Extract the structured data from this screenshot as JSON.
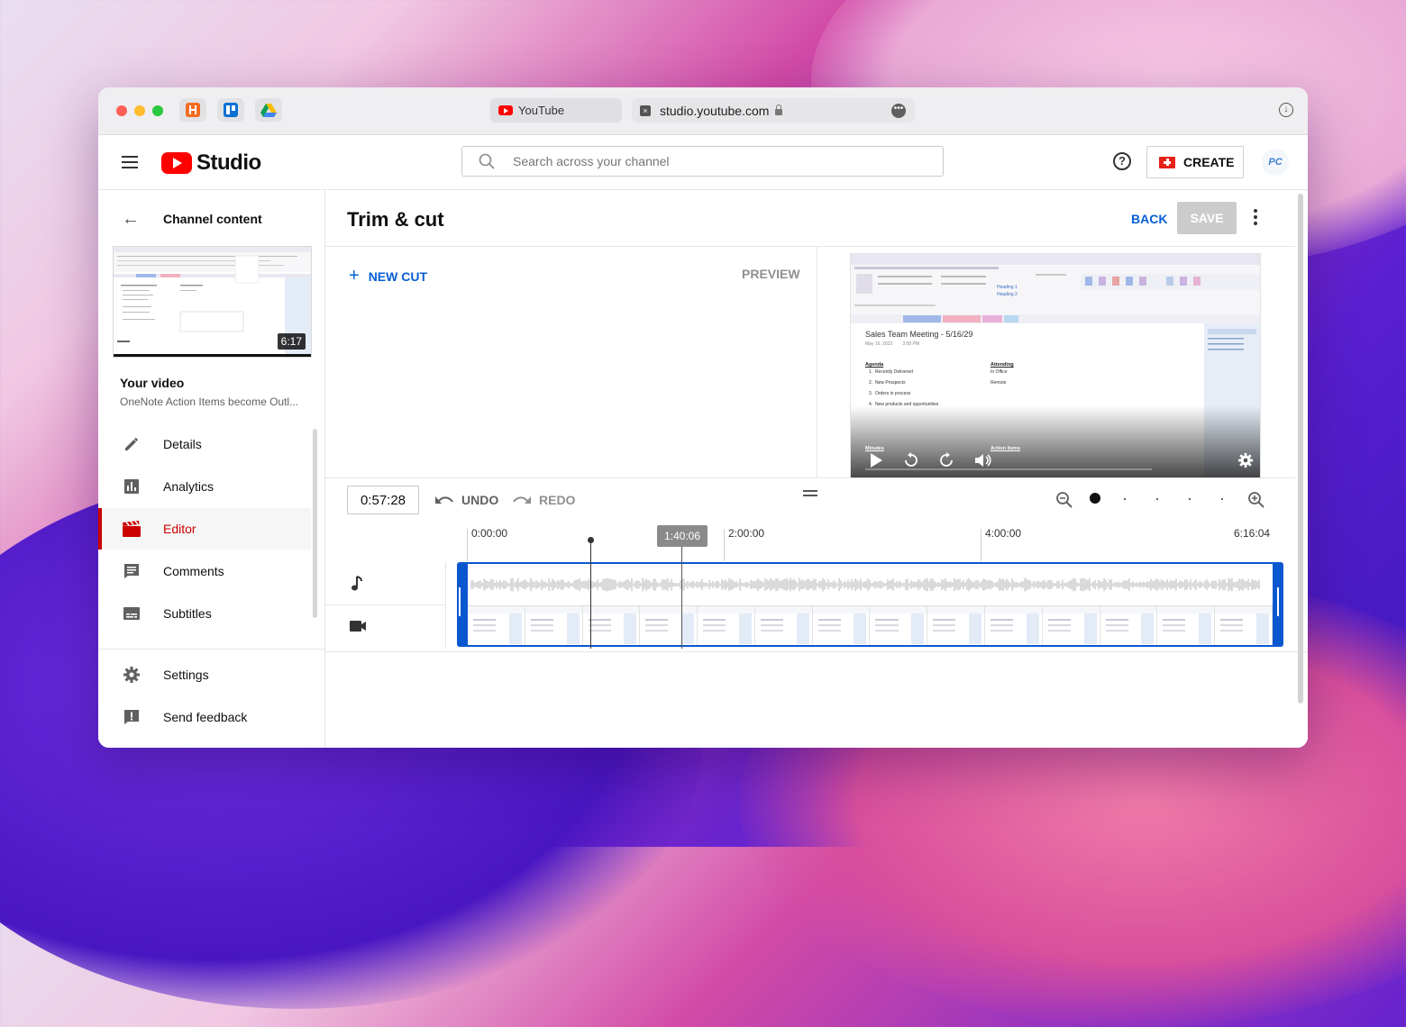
{
  "browser": {
    "tab_title": "YouTube",
    "address": "studio.youtube.com"
  },
  "header": {
    "brand": "Studio",
    "search_placeholder": "Search across your channel",
    "create_label": "CREATE",
    "avatar_text": "PC"
  },
  "sidebar": {
    "back_label": "Channel content",
    "thumb_duration": "6:17",
    "your_video_label": "Your video",
    "video_title": "OneNote Action Items become Outl...",
    "items": [
      {
        "label": "Details",
        "icon": "pencil-icon"
      },
      {
        "label": "Analytics",
        "icon": "analytics-icon"
      },
      {
        "label": "Editor",
        "icon": "clapperboard-icon",
        "active": true
      },
      {
        "label": "Comments",
        "icon": "comments-icon"
      },
      {
        "label": "Subtitles",
        "icon": "subtitles-icon"
      }
    ],
    "bottom_items": [
      {
        "label": "Settings",
        "icon": "gear-icon"
      },
      {
        "label": "Send feedback",
        "icon": "feedback-icon"
      }
    ]
  },
  "editor": {
    "title": "Trim & cut",
    "back_label": "BACK",
    "save_label": "SAVE",
    "new_cut_label": "NEW CUT",
    "preview_label": "PREVIEW",
    "current_time": "0:57:28",
    "undo_label": "UNDO",
    "redo_label": "REDO",
    "playhead_time": "1:40:06",
    "ruler": [
      "0:00:00",
      "2:00:00",
      "4:00:00",
      "6:16:04"
    ]
  },
  "preview_video": {
    "page_heading": "Sales Team Meeting - 5/16/29",
    "page_date": "May 16, 2023        3:00 PM",
    "agenda_label": "Agenda",
    "agenda_items": [
      "1.  Recently Delivered",
      "2.  New Prospects",
      "3.  Orders in process",
      "4.  New products and opportunities"
    ],
    "attending_label": "Attending",
    "attending_items": [
      "In Office",
      "Remote"
    ],
    "minutes_label": "Minutes",
    "action_items_label": "Action Items",
    "ribbon_heading1": "Heading 1",
    "ribbon_heading2": "Heading 2"
  },
  "colors": {
    "accent_blue": "#065fd4",
    "active_red": "#cc0000",
    "timeline_blue": "#0b57d0"
  }
}
